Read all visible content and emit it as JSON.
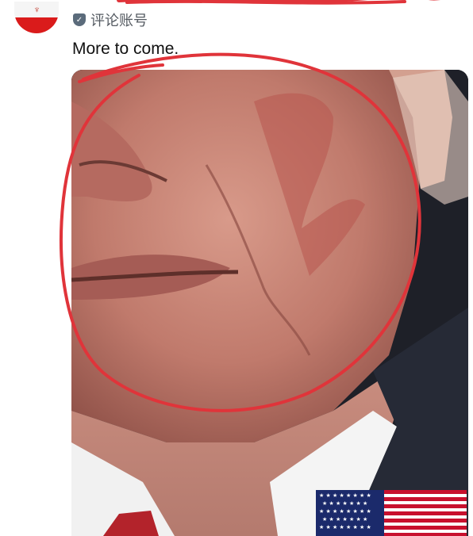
{
  "post": {
    "account_label": "评论账号",
    "text": "More to come."
  },
  "icons": {
    "avatar": "iran-flag-avatar",
    "badge": "shield-icon",
    "flag": "us-flag-icon"
  },
  "colors": {
    "annotation": "#e0343a",
    "text": "#111111"
  }
}
